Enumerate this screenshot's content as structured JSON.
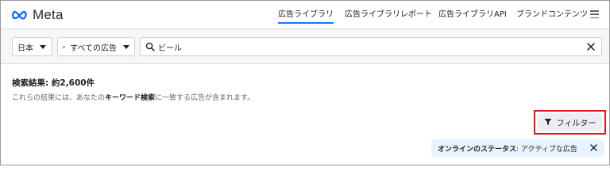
{
  "header": {
    "logo_text": "Meta",
    "nav": [
      {
        "label": "広告ライブラリ",
        "active": true
      },
      {
        "label": "広告ライブラリレポート",
        "active": false
      },
      {
        "label": "広告ライブラリAPI",
        "active": false
      },
      {
        "label": "ブランドコンテンツ",
        "active": false
      }
    ],
    "menu_icon": "hamburger-menu-icon"
  },
  "search_row": {
    "country": "日本",
    "ad_category": "すべての広告",
    "search_value": "ビール",
    "icons": {
      "search": "search-icon",
      "clear": "close-icon",
      "category": "monitor-icon"
    }
  },
  "results": {
    "title": "検索結果: 約2,600件",
    "desc_before": "これらの結果には、あなたの",
    "desc_keyword": "キーワード検索",
    "desc_after": "に一致する広告が含まれます。"
  },
  "filter": {
    "label": "フィルター",
    "icon": "funnel-icon",
    "highlight_color": "#e0191f"
  },
  "status_chip": {
    "label_bold": "オンラインのステータス",
    "label_rest": ": アクティブな広告",
    "close_icon": "close-icon"
  },
  "colors": {
    "accent": "#1877f2",
    "chip_bg": "#e7f3ff"
  }
}
